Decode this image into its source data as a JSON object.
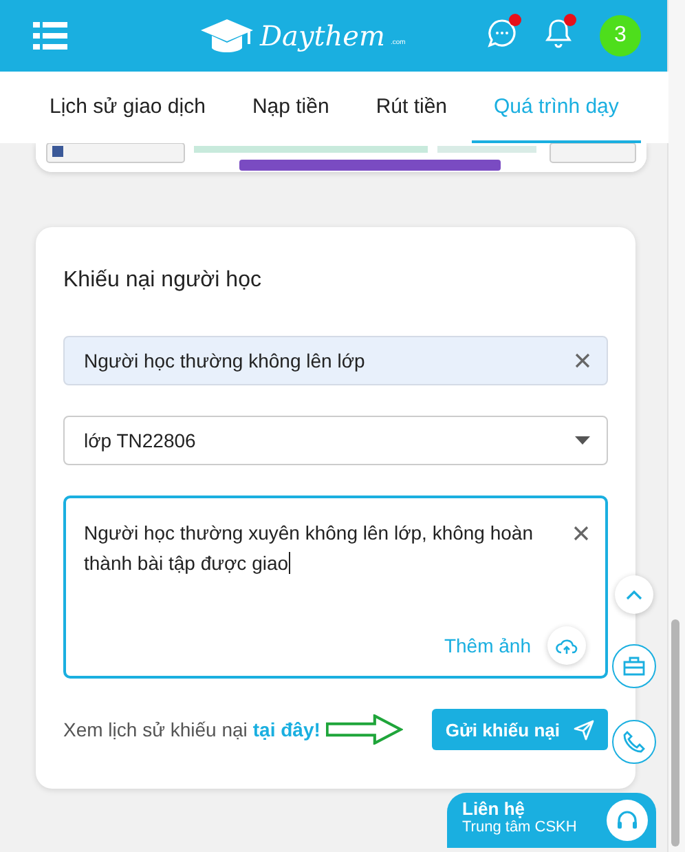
{
  "header": {
    "logo": {
      "name": "Daythem",
      "suffix": ".com"
    },
    "messages_badge": true,
    "notifications_badge": true,
    "avatar": "3"
  },
  "tabs": [
    {
      "label": "Lịch sử giao dịch",
      "selected": false
    },
    {
      "label": "Nạp tiền",
      "selected": false
    },
    {
      "label": "Rút tiền",
      "selected": false
    },
    {
      "label": "Quá trình dạy",
      "selected": true
    }
  ],
  "complaint": {
    "title": "Khiếu nại người học",
    "reason": {
      "value": "Người học thường không lên lớp",
      "clearable": true
    },
    "class_select": {
      "value": "lớp TN22806"
    },
    "description": {
      "value": "Người học thường xuyên không lên lớp, không hoàn thành bài tập được giao",
      "clearable": true
    },
    "add_photo": "Thêm ảnh",
    "history_text": "Xem lịch sử khiếu nại",
    "history_link": "tại đây!",
    "submit": "Gửi khiếu nại"
  },
  "contact": {
    "title": "Liên hệ",
    "subtitle": "Trung tâm CSKH"
  }
}
